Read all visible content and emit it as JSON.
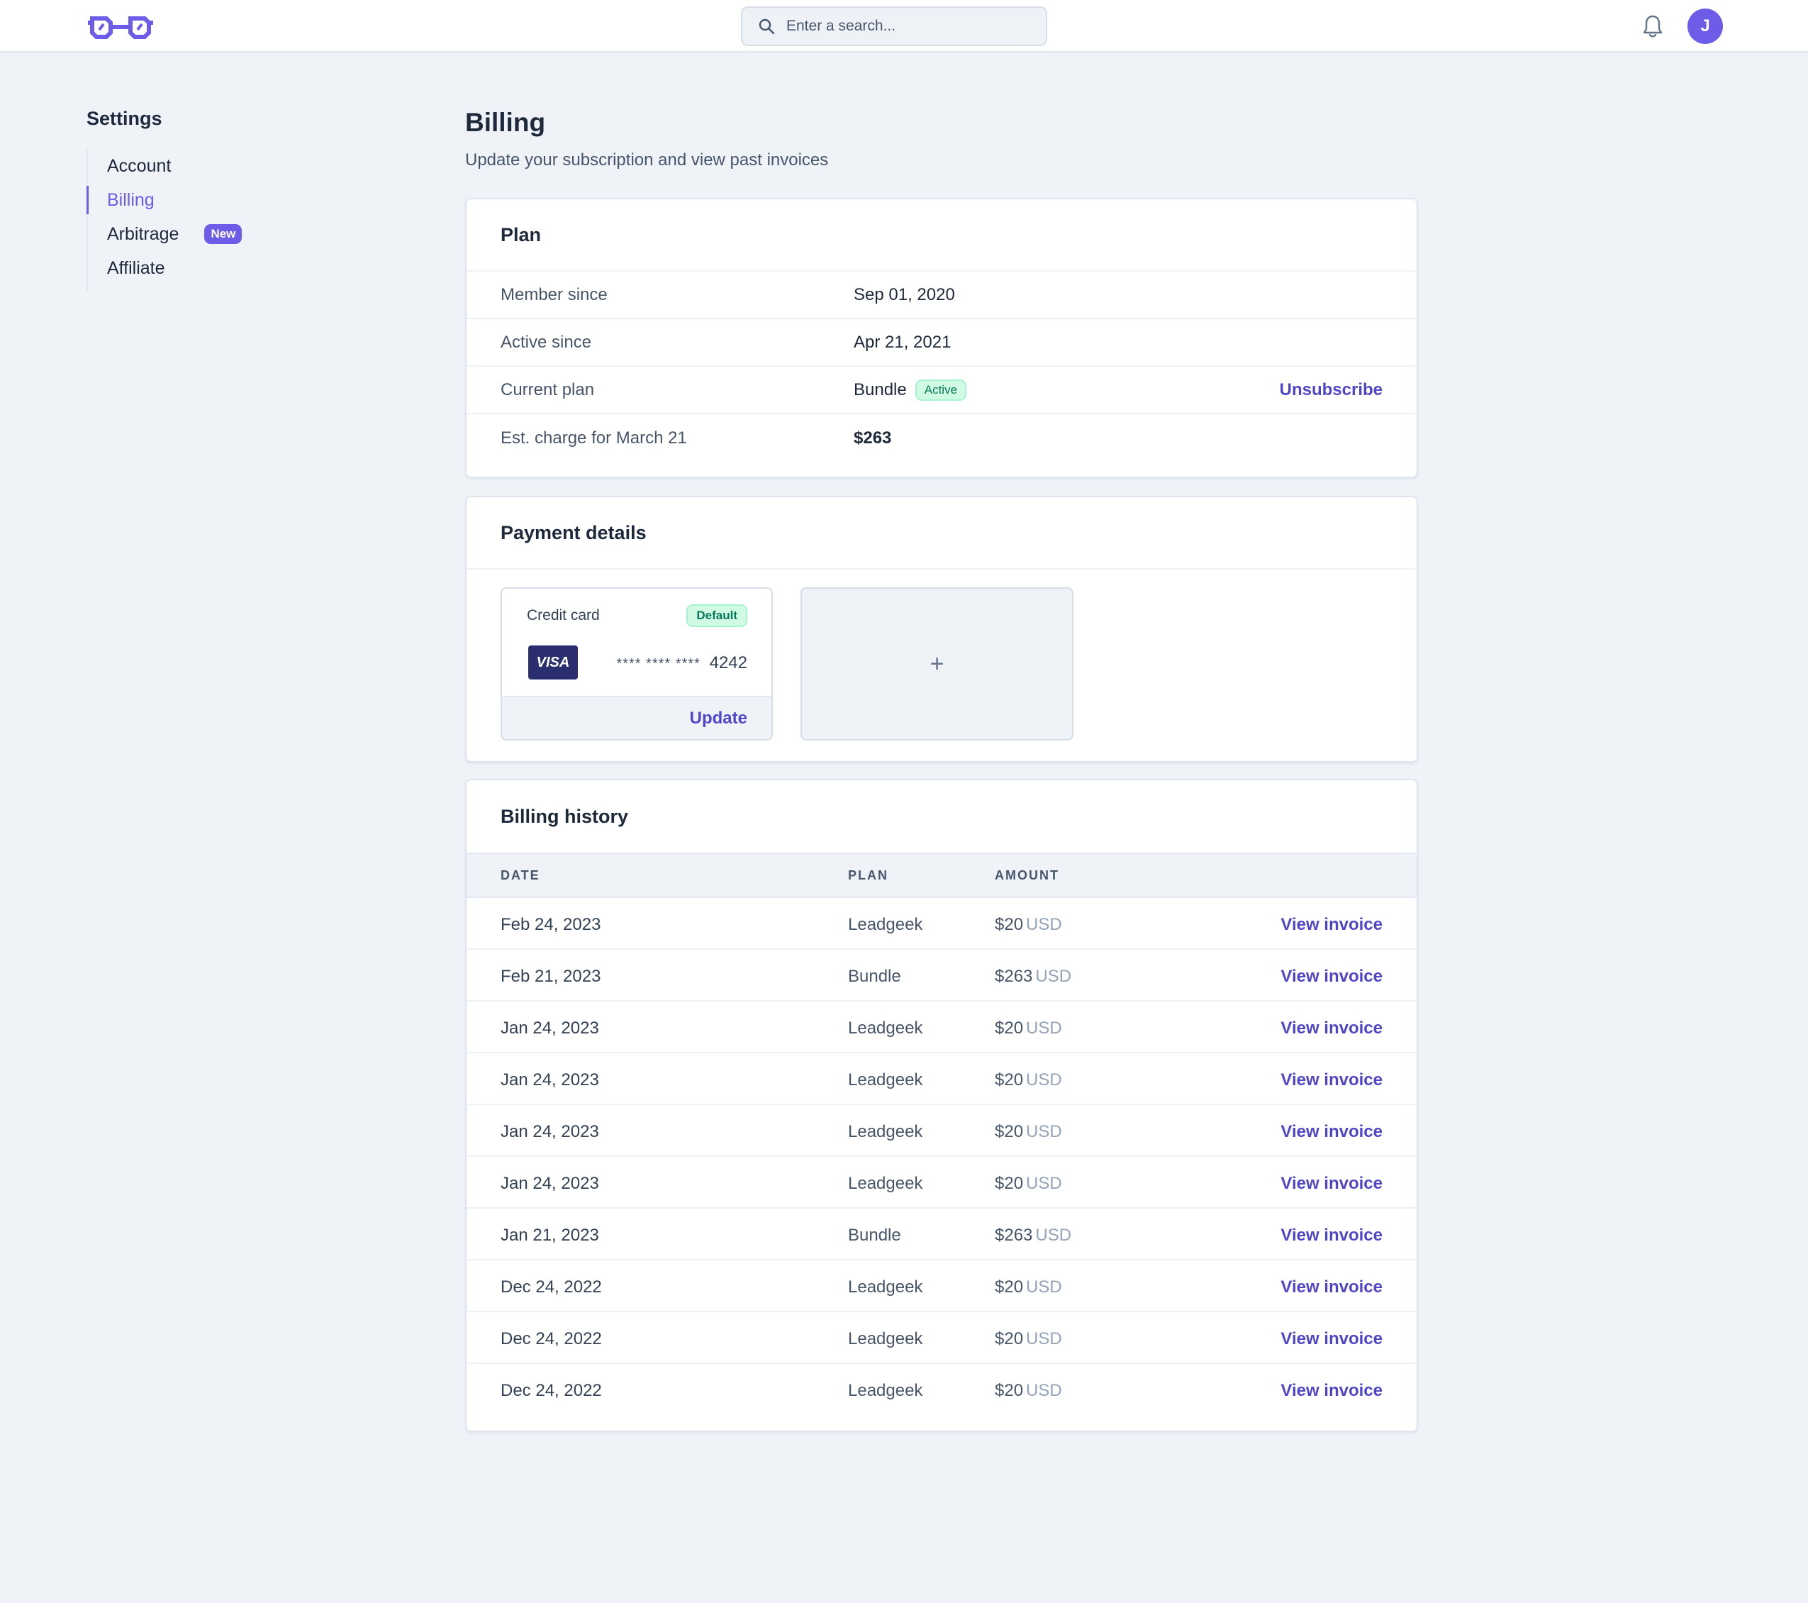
{
  "header": {
    "search_placeholder": "Enter a search...",
    "avatar_initial": "J"
  },
  "sidebar": {
    "title": "Settings",
    "items": [
      {
        "label": "Account"
      },
      {
        "label": "Billing",
        "active": true
      },
      {
        "label": "Arbitrage",
        "badge": "New"
      },
      {
        "label": "Affiliate"
      }
    ]
  },
  "page": {
    "title": "Billing",
    "subtitle": "Update your subscription and view past invoices"
  },
  "plan": {
    "title": "Plan",
    "rows": [
      {
        "label": "Member since",
        "value": "Sep 01, 2020"
      },
      {
        "label": "Active since",
        "value": "Apr 21, 2021"
      },
      {
        "label": "Current plan",
        "value": "Bundle",
        "badge": "Active",
        "action": "Unsubscribe"
      },
      {
        "label": "Est. charge for March 21",
        "value": "$263"
      }
    ]
  },
  "payment": {
    "title": "Payment details",
    "card_label": "Credit card",
    "default_badge": "Default",
    "brand": "VISA",
    "masked": "**** **** ****",
    "last4": "4242",
    "update_label": "Update",
    "add_symbol": "+"
  },
  "history": {
    "title": "Billing history",
    "columns": [
      "DATE",
      "PLAN",
      "AMOUNT"
    ],
    "rows": [
      {
        "date": "Feb 24, 2023",
        "plan": "Leadgeek",
        "amount": "$20",
        "currency": "USD",
        "link": "View invoice"
      },
      {
        "date": "Feb 21, 2023",
        "plan": "Bundle",
        "amount": "$263",
        "currency": "USD",
        "link": "View invoice"
      },
      {
        "date": "Jan 24, 2023",
        "plan": "Leadgeek",
        "amount": "$20",
        "currency": "USD",
        "link": "View invoice"
      },
      {
        "date": "Jan 24, 2023",
        "plan": "Leadgeek",
        "amount": "$20",
        "currency": "USD",
        "link": "View invoice"
      },
      {
        "date": "Jan 24, 2023",
        "plan": "Leadgeek",
        "amount": "$20",
        "currency": "USD",
        "link": "View invoice"
      },
      {
        "date": "Jan 24, 2023",
        "plan": "Leadgeek",
        "amount": "$20",
        "currency": "USD",
        "link": "View invoice"
      },
      {
        "date": "Jan 21, 2023",
        "plan": "Bundle",
        "amount": "$263",
        "currency": "USD",
        "link": "View invoice"
      },
      {
        "date": "Dec 24, 2022",
        "plan": "Leadgeek",
        "amount": "$20",
        "currency": "USD",
        "link": "View invoice"
      },
      {
        "date": "Dec 24, 2022",
        "plan": "Leadgeek",
        "amount": "$20",
        "currency": "USD",
        "link": "View invoice"
      },
      {
        "date": "Dec 24, 2022",
        "plan": "Leadgeek",
        "amount": "$20",
        "currency": "USD",
        "link": "View invoice"
      }
    ]
  },
  "colors": {
    "accent": "#6c5ce7",
    "link": "#4f46c9",
    "success_bg": "#d1fae5",
    "success_text": "#047857"
  }
}
